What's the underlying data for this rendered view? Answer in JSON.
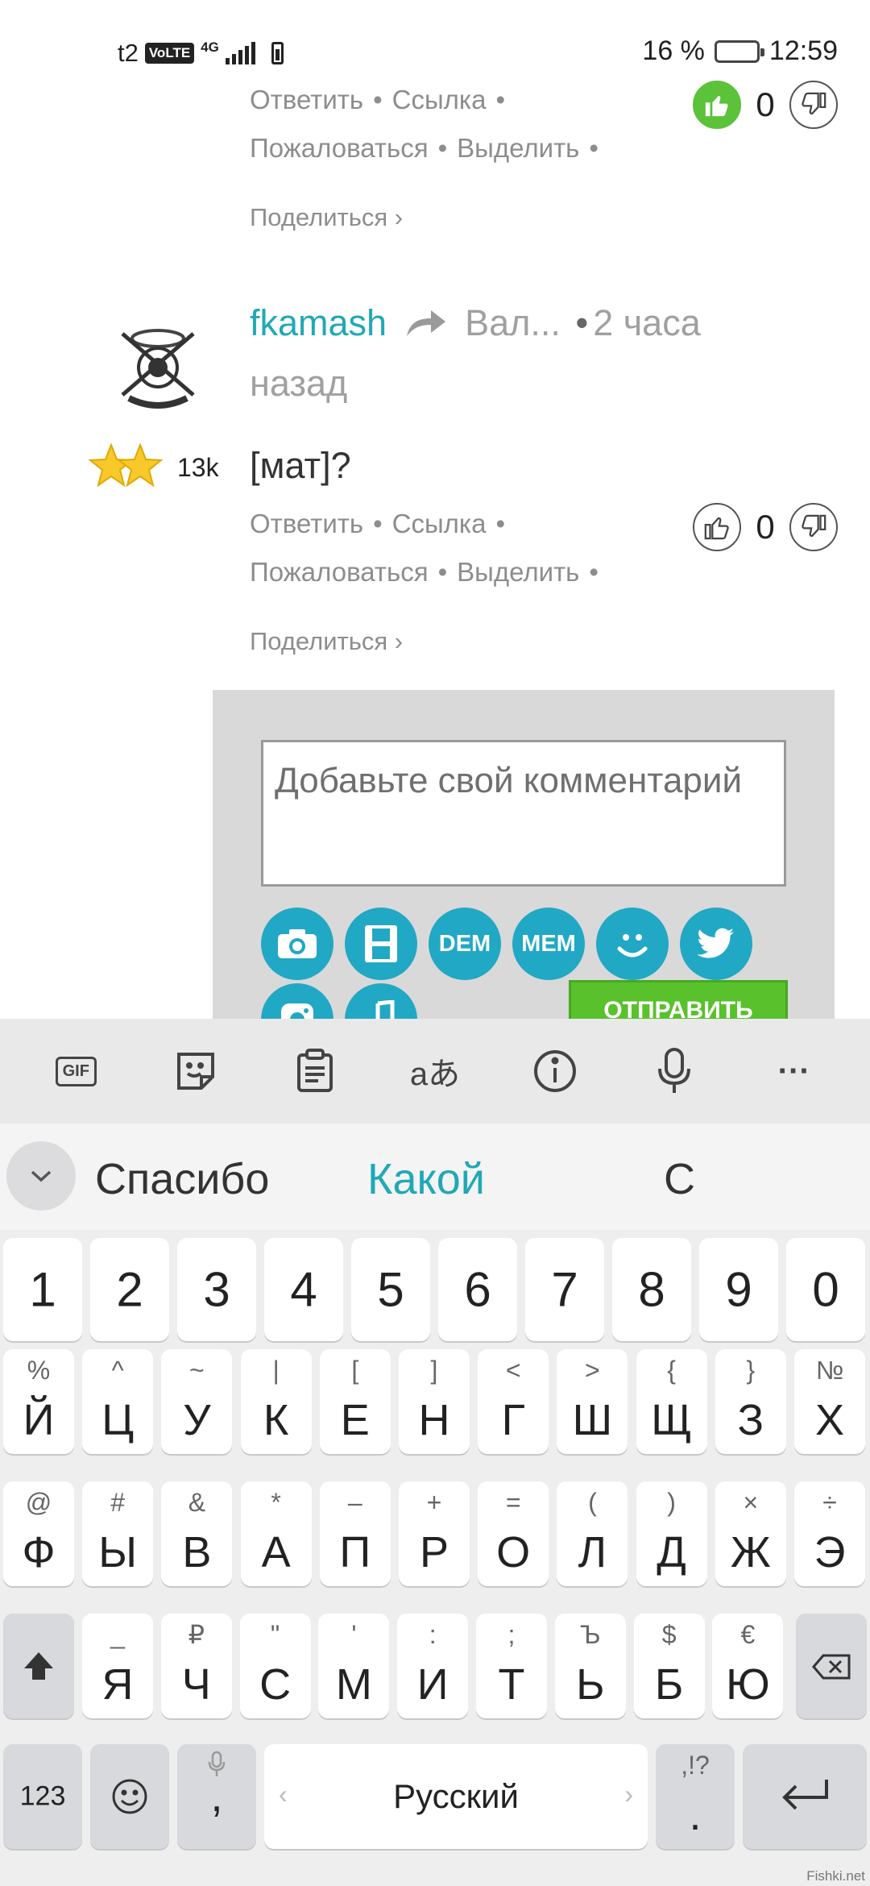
{
  "status_bar": {
    "carrier": "t2",
    "volte": "VoLTE",
    "network": "4G",
    "battery_text": "16 %",
    "battery_level": 0.16,
    "time": "12:59"
  },
  "prev_comment": {
    "actions": [
      "Ответить",
      "Ссылка",
      "Пожаловаться",
      "Выделить"
    ],
    "share": "Поделиться ›",
    "votes": "0"
  },
  "comment": {
    "username": "fkamash",
    "reply_to": "Вал...",
    "time_ago": "2 часа назад",
    "rating": "13k",
    "text": "[мат]?",
    "actions": [
      "Ответить",
      "Ссылка",
      "Пожаловаться",
      "Выделить"
    ],
    "share": "Поделиться ›",
    "votes": "0"
  },
  "form": {
    "placeholder": "Добавьте свой комментарий",
    "tools": [
      "camera",
      "video",
      "DEM",
      "MEM",
      "smiley",
      "twitter",
      "instagram",
      "music"
    ],
    "dem_label": "DEM",
    "mem_label": "MEM",
    "send_label": "ОТПРАВИТЬ"
  },
  "keyboard": {
    "toolbar": [
      "GIF",
      "sticker",
      "clipboard",
      "translate",
      "info",
      "mic",
      "more"
    ],
    "gif_label": "GIF",
    "translate_label": "aあ",
    "more_label": "···",
    "suggestions": [
      "Спасибо",
      "Какой",
      "С"
    ],
    "numbers": [
      "1",
      "2",
      "3",
      "4",
      "5",
      "6",
      "7",
      "8",
      "9",
      "0"
    ],
    "row1": [
      {
        "main": "Й",
        "sec": "%"
      },
      {
        "main": "Ц",
        "sec": "^"
      },
      {
        "main": "У",
        "sec": "~"
      },
      {
        "main": "К",
        "sec": "|"
      },
      {
        "main": "Е",
        "sec": "["
      },
      {
        "main": "Н",
        "sec": "]"
      },
      {
        "main": "Г",
        "sec": "<"
      },
      {
        "main": "Ш",
        "sec": ">"
      },
      {
        "main": "Щ",
        "sec": "{"
      },
      {
        "main": "З",
        "sec": "}"
      },
      {
        "main": "Х",
        "sec": "№"
      }
    ],
    "row2": [
      {
        "main": "Ф",
        "sec": "@"
      },
      {
        "main": "Ы",
        "sec": "#"
      },
      {
        "main": "В",
        "sec": "&"
      },
      {
        "main": "А",
        "sec": "*"
      },
      {
        "main": "П",
        "sec": "–"
      },
      {
        "main": "Р",
        "sec": "+"
      },
      {
        "main": "О",
        "sec": "="
      },
      {
        "main": "Л",
        "sec": "("
      },
      {
        "main": "Д",
        "sec": ")"
      },
      {
        "main": "Ж",
        "sec": "×"
      },
      {
        "main": "Э",
        "sec": "÷"
      }
    ],
    "row3": [
      {
        "main": "Я",
        "sec": "_"
      },
      {
        "main": "Ч",
        "sec": "₽"
      },
      {
        "main": "С",
        "sec": "\""
      },
      {
        "main": "М",
        "sec": "'"
      },
      {
        "main": "И",
        "sec": ":"
      },
      {
        "main": "Т",
        "sec": ";"
      },
      {
        "main": "Ь",
        "sec": "Ъ"
      },
      {
        "main": "Б",
        "sec": "$"
      },
      {
        "main": "Ю",
        "sec": "€"
      }
    ],
    "key_123": "123",
    "comma": ",",
    "space_label": "Русский",
    "period": ".",
    "period_alt": ",!?"
  },
  "watermark": "Fishki.net",
  "colors": {
    "accent": "#21a8b7",
    "like_active": "#5cc23a",
    "send": "#59c12c",
    "tool_bg": "#21a8c4",
    "battery_low": "#f39a1c"
  }
}
